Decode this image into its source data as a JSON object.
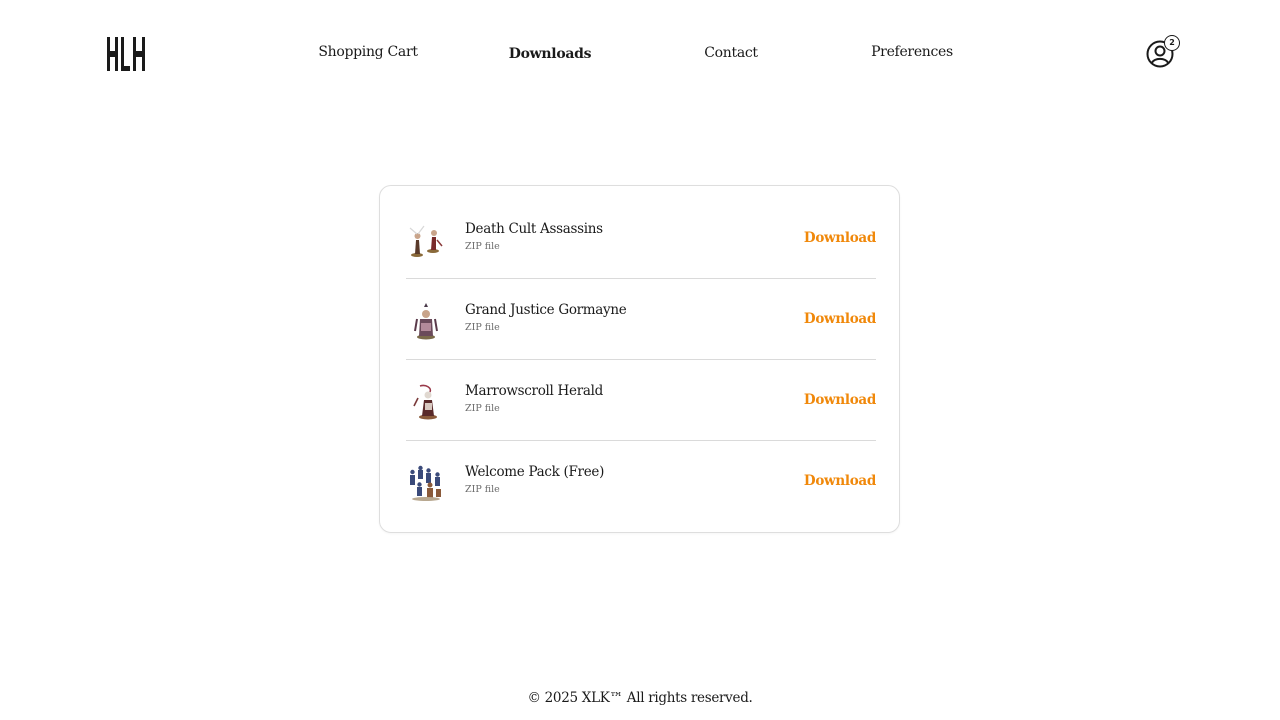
{
  "header": {
    "logo_text": "XLK",
    "nav": [
      {
        "label": "Shopping Cart",
        "active": false
      },
      {
        "label": "Downloads",
        "active": true
      },
      {
        "label": "Contact",
        "active": false
      },
      {
        "label": "Preferences",
        "active": false
      }
    ],
    "user_icon": "user-circle-icon",
    "notification_count": "2"
  },
  "downloads": {
    "items": [
      {
        "name": "Death Cult Assassins",
        "type": "ZIP file",
        "action": "Download",
        "thumbnail": "miniature-pair-thumbnail"
      },
      {
        "name": "Grand Justice Gormayne",
        "type": "ZIP file",
        "action": "Download",
        "thumbnail": "miniature-single-thumbnail"
      },
      {
        "name": "Marrowscroll Herald",
        "type": "ZIP file",
        "action": "Download",
        "thumbnail": "miniature-single-thumbnail"
      },
      {
        "name": "Welcome Pack (Free)",
        "type": "ZIP file",
        "action": "Download",
        "thumbnail": "miniature-group-thumbnail"
      }
    ]
  },
  "footer": {
    "text": "© 2025 XLK™ All rights reserved."
  },
  "colors": {
    "accent": "#f0880a",
    "text": "#1a1a1a",
    "muted": "#6b6b6b",
    "border": "#dedede"
  }
}
